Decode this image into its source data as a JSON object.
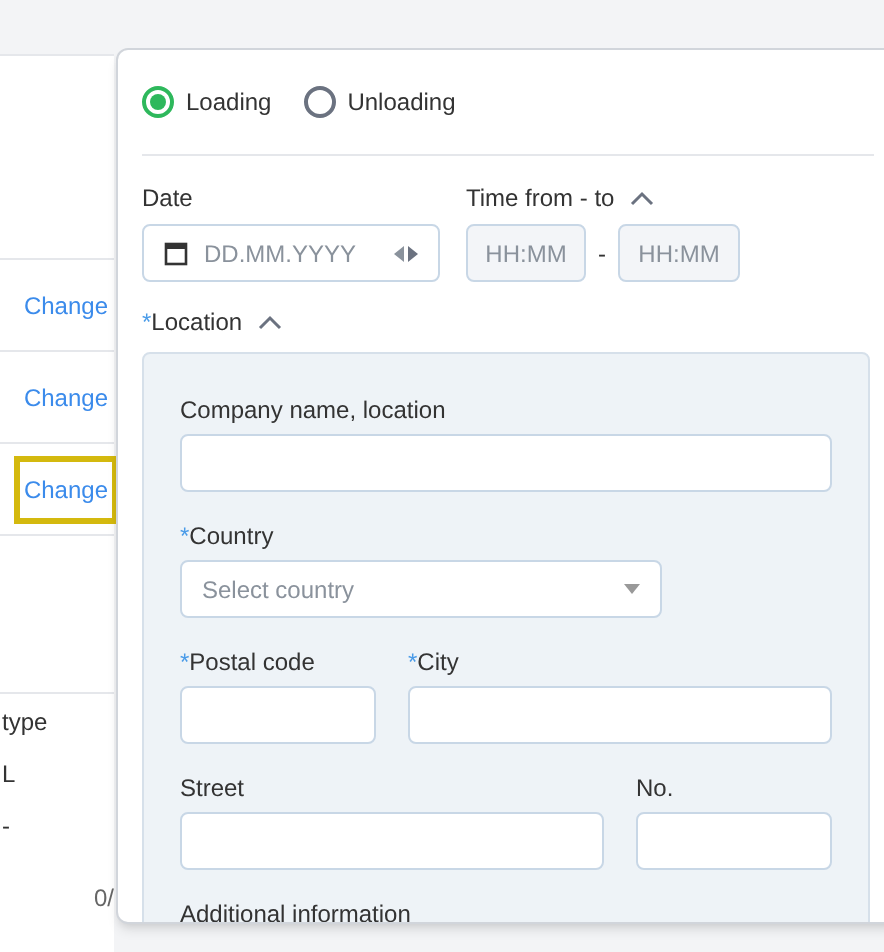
{
  "background": {
    "change_links": [
      {
        "label": "Change",
        "focused": false
      },
      {
        "label": "Change",
        "focused": false
      },
      {
        "label": "Change",
        "focused": true
      }
    ],
    "column_texts": [
      "type",
      "L",
      "-"
    ],
    "counter": "0/"
  },
  "popover": {
    "stop_types": [
      {
        "label": "Loading",
        "selected": true
      },
      {
        "label": "Unloading",
        "selected": false
      }
    ],
    "date": {
      "label": "Date",
      "placeholder": "DD.MM.YYYY"
    },
    "time": {
      "label": "Time from - to",
      "expanded": true,
      "from_placeholder": "HH:MM",
      "separator": "-",
      "to_placeholder": "HH:MM"
    },
    "location": {
      "label": "Location",
      "required_mark": "*",
      "expanded": true,
      "fields": [
        {
          "label": "Company name, location",
          "kind": "text"
        },
        {
          "label": "Country",
          "required_mark": "*",
          "kind": "select",
          "placeholder": "Select country"
        },
        {
          "label": "Postal code",
          "required_mark": "*",
          "kind": "text"
        },
        {
          "label": "City",
          "required_mark": "*",
          "kind": "text"
        },
        {
          "label": "Street",
          "kind": "text"
        },
        {
          "label": "No.",
          "kind": "text"
        },
        {
          "label": "Additional information",
          "kind": "label"
        }
      ]
    }
  }
}
